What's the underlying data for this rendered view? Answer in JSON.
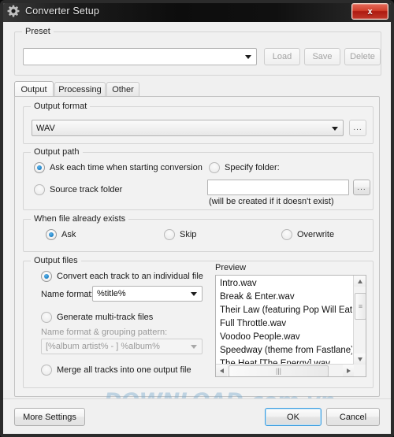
{
  "window": {
    "title": "Converter Setup",
    "gear_icon": "gear-icon",
    "close_label": "x",
    "accent_close": "#c0382a",
    "accent_focus": "#3d9ee0"
  },
  "preset": {
    "group_label": "Preset",
    "value": "",
    "buttons": [
      {
        "label": "Load",
        "disabled": true
      },
      {
        "label": "Save",
        "disabled": true
      },
      {
        "label": "Delete",
        "disabled": true
      }
    ]
  },
  "tabs": [
    {
      "label": "Output",
      "active": true
    },
    {
      "label": "Processing",
      "active": false
    },
    {
      "label": "Other",
      "active": false
    }
  ],
  "output_format": {
    "group_label": "Output format",
    "value": "WAV",
    "browse_label": "..."
  },
  "output_path": {
    "group_label": "Output path",
    "options": [
      {
        "label": "Ask each time when starting conversion",
        "selected": true
      },
      {
        "label": "Source track folder",
        "selected": false
      },
      {
        "label": "Specify folder:",
        "selected": false
      }
    ],
    "folder_value": "",
    "browse_label": "...",
    "hint": "(will be created if it doesn't exist)"
  },
  "file_exists": {
    "group_label": "When file already exists",
    "options": [
      {
        "label": "Ask",
        "selected": true
      },
      {
        "label": "Skip",
        "selected": false
      },
      {
        "label": "Overwrite",
        "selected": false
      }
    ]
  },
  "output_files": {
    "group_label": "Output files",
    "individual": {
      "label": "Convert each track to an individual file",
      "selected": true
    },
    "name_format_label": "Name format:",
    "name_format_value": "%title%",
    "multitrack": {
      "label": "Generate multi-track files",
      "selected": false
    },
    "grouping_label": "Name format & grouping pattern:",
    "grouping_value": "[%album artist% - ] %album%",
    "merge": {
      "label": "Merge all tracks into one output file",
      "selected": false
    }
  },
  "preview": {
    "label": "Preview",
    "items": [
      "Intro.wav",
      "Break & Enter.wav",
      "Their Law (featuring Pop Will Eat Itself).wav",
      "Full Throttle.wav",
      "Voodoo People.wav",
      "Speedway (theme from Fastlane).wav",
      "The Heat [The Energy].wav"
    ]
  },
  "footer": {
    "more_settings": "More Settings",
    "ok": "OK",
    "cancel": "Cancel"
  },
  "watermark": {
    "text": "DOWNLOAD.com.vn"
  }
}
